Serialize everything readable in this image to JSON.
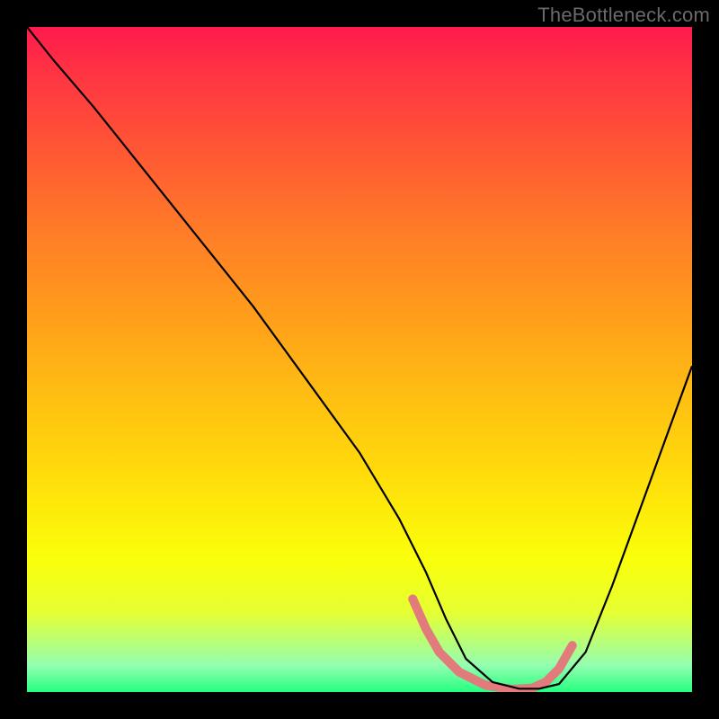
{
  "watermark": "TheBottleneck.com",
  "chart_data": {
    "type": "line",
    "title": "",
    "xlabel": "",
    "ylabel": "",
    "xlim": [
      0,
      100
    ],
    "ylim": [
      0,
      100
    ],
    "series": [
      {
        "name": "bottleneck-curve",
        "x": [
          0,
          4,
          10,
          18,
          26,
          34,
          42,
          50,
          56,
          60,
          63,
          66,
          70,
          74,
          77,
          80,
          84,
          88,
          92,
          96,
          100
        ],
        "y": [
          100,
          95,
          88,
          78,
          68,
          58,
          47,
          36,
          26,
          18,
          11,
          5,
          1.5,
          0.5,
          0.5,
          1.2,
          6,
          16,
          27,
          38,
          49
        ],
        "stroke": "#000000",
        "width": 2.2
      },
      {
        "name": "highlight-band",
        "x": [
          58,
          60,
          62,
          65,
          69,
          73,
          76,
          78,
          80,
          82
        ],
        "y": [
          14,
          9.5,
          6,
          3,
          1,
          0.4,
          0.6,
          1.5,
          3.5,
          7
        ],
        "stroke": "#e27b7b",
        "width": 10,
        "linecap": "round"
      }
    ]
  }
}
